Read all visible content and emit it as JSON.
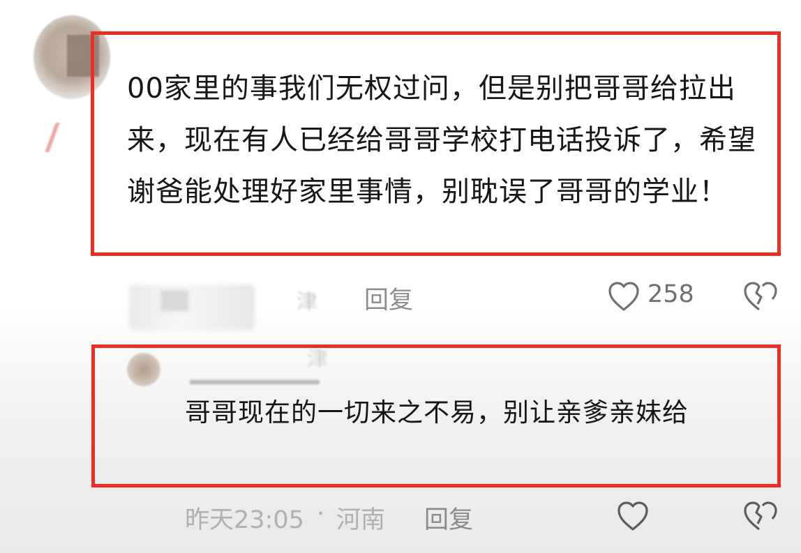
{
  "comment": {
    "text": "00家里的事我们无权过问，但是别把哥哥给拉出来，现在有人已经给哥哥学校打电话投诉了，希望谢爸能处理好家里事情，别耽误了哥哥的学业！",
    "reply_label": "回复",
    "like_count": "258",
    "like_icon": "heart-outline-icon",
    "dislike_icon": "broken-heart-icon",
    "highlight_color": "#ee2c24"
  },
  "reply": {
    "text": "哥哥现在的一切来之不易，别让亲爹亲妹给",
    "time": "昨天23:05",
    "separator": "·",
    "location": "河南",
    "reply_label": "回复",
    "like_icon": "heart-outline-icon",
    "dislike_icon": "broken-heart-icon"
  }
}
